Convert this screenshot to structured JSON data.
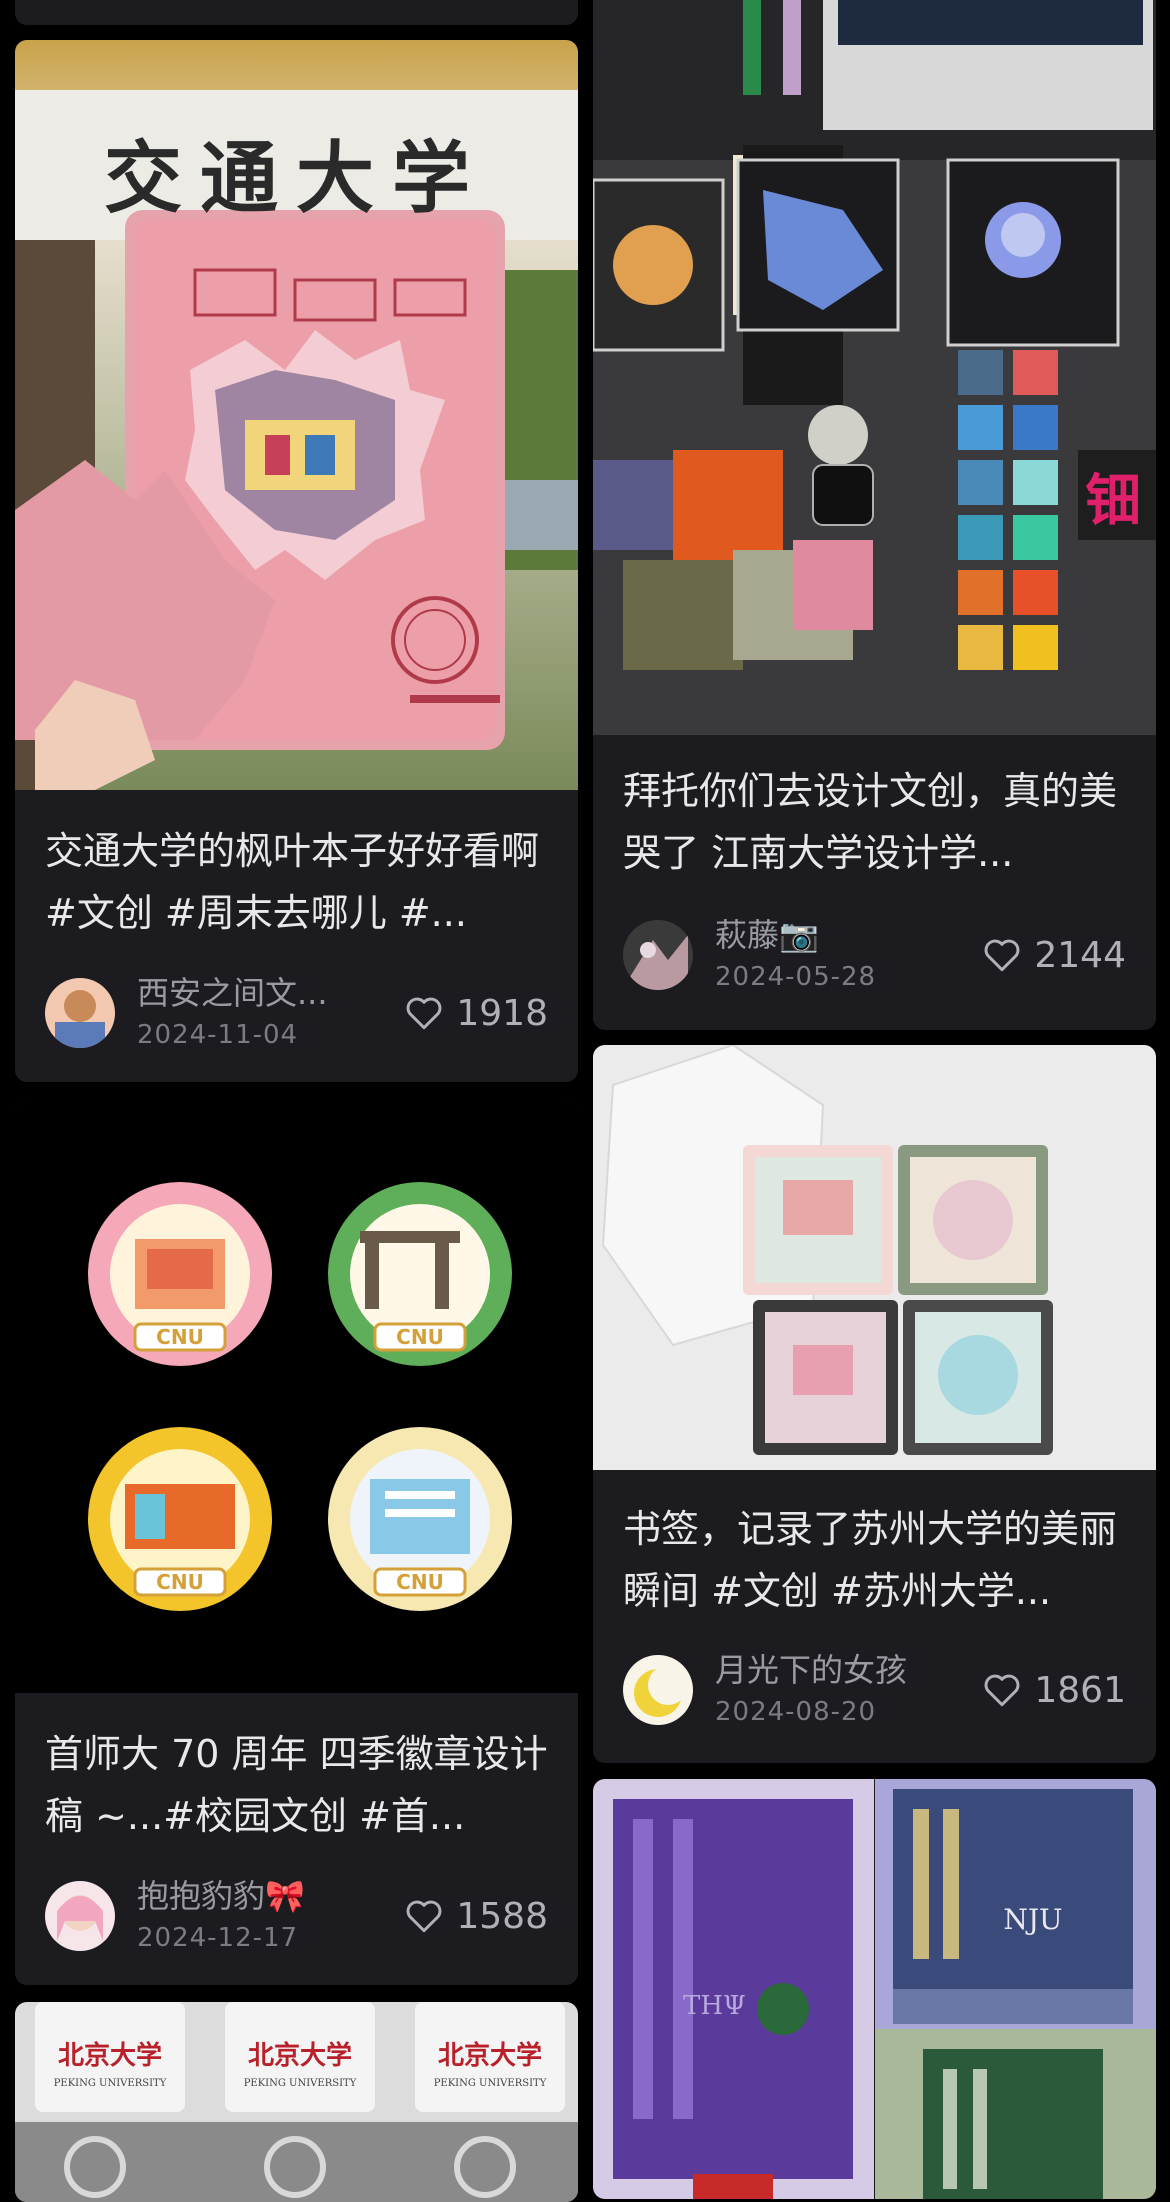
{
  "colors": {
    "background": "#000000",
    "card": "#1c1c20",
    "title": "#e8e8ec",
    "meta": "#9a9aa2"
  },
  "cards": [
    {
      "image_alt": "交通大学 maple leaf notebook",
      "image_text": "交通大学",
      "title": "交通大学的枫叶本子好好看啊 #文创 #周末去哪儿 #...",
      "author": "西安之间文...",
      "date": "2024-11-04",
      "likes": "1918",
      "like_icon": "heart-outline-icon"
    },
    {
      "image_alt": "CNU four seasons badge designs",
      "badge_label": "CNU",
      "title": "首师大 70 周年 四季徽章设计稿 ~...#校园文创 #首...",
      "author": "抱抱豹豹🎀",
      "date": "2024-12-17",
      "likes": "1588",
      "like_icon": "heart-outline-icon"
    },
    {
      "image_alt": "北京大学 souvenir tags",
      "image_text": "北京大学",
      "image_subtext": "PEKING UNIVERSITY"
    },
    {
      "image_alt": "江南大学 design cultural products"
    },
    {
      "title": "拜托你们去设计文创，真的美哭了 江南大学设计学...",
      "author": "萩藤📷",
      "date": "2024-05-28",
      "likes": "2144",
      "like_icon": "heart-outline-icon"
    },
    {
      "image_alt": "苏州大学 bookmarks in boxes",
      "title": "书签，记录了苏州大学的美丽瞬间 #文创 #苏州大学...",
      "author": "月光下的女孩",
      "date": "2024-08-20",
      "likes": "1861",
      "like_icon": "heart-outline-icon"
    },
    {
      "image_alt": "university scarves",
      "scarf_text": "NJU"
    }
  ]
}
